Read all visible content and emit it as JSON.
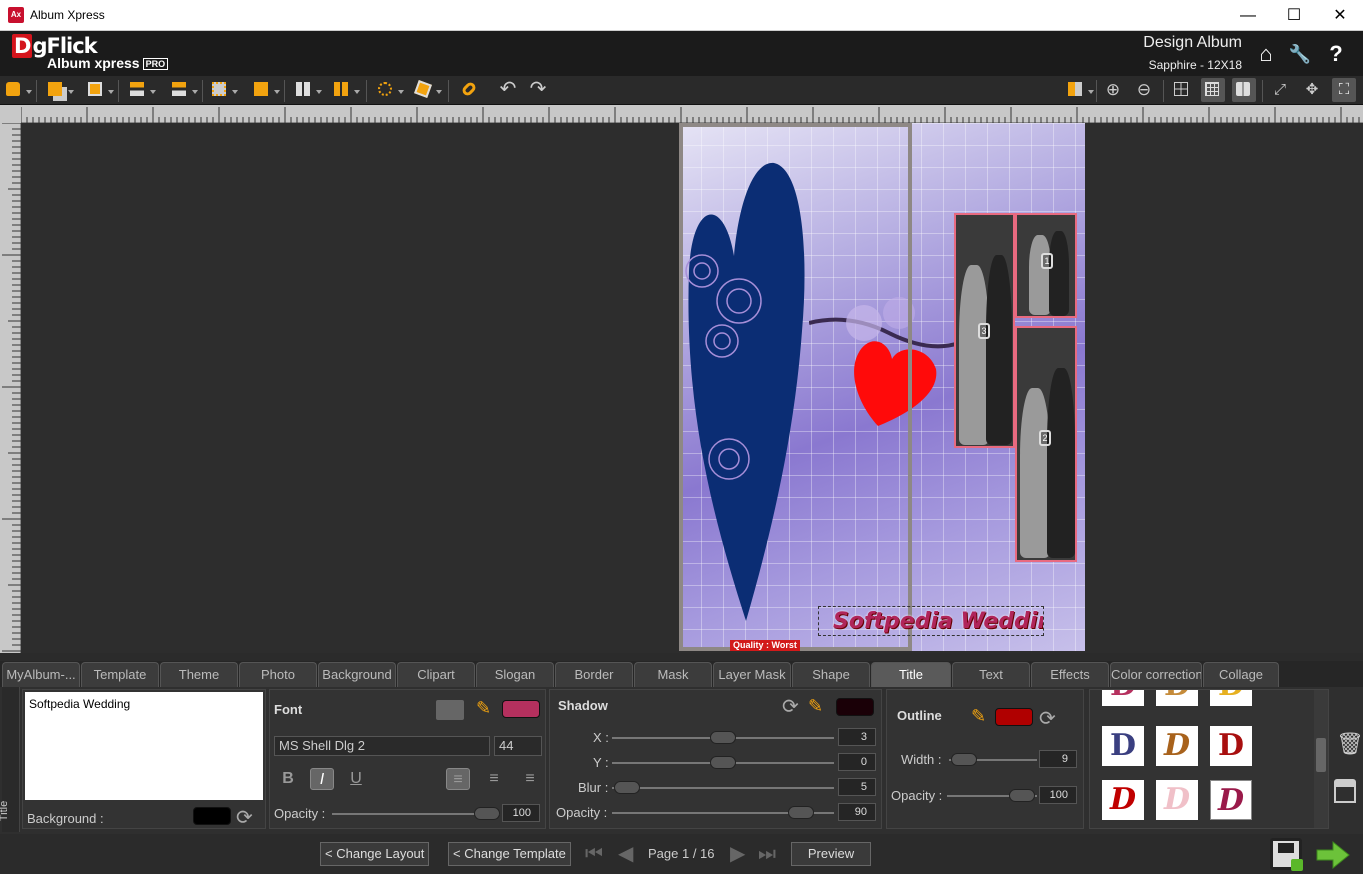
{
  "window": {
    "title": "Album Xpress",
    "minimize": "—",
    "maximize": "☐",
    "close": "✕"
  },
  "header": {
    "brand": "DgFlick",
    "brand_d": "D",
    "brand_rest": "gFlick",
    "product": "Album xpress",
    "edition": "PRO",
    "mode_title": "Design Album",
    "album_info": "Sapphire - 12X18",
    "home_icon": "⌂",
    "settings_icon": "🔧",
    "help_icon": "?"
  },
  "canvas": {
    "title_text": "Softpedia Wedding",
    "quality_badge": "Quality : Worst",
    "photo_numbers": [
      "3",
      "1",
      "2"
    ]
  },
  "tabs": [
    "MyAlbum-...",
    "Template",
    "Theme",
    "Photo",
    "Background",
    "Clipart",
    "Slogan",
    "Border",
    "Mask",
    "Layer Mask",
    "Shape",
    "Title",
    "Text",
    "Effects",
    "Color correction",
    "Collage"
  ],
  "active_tab": "Title",
  "title_panel": {
    "side_label": "Title",
    "text_value": "Softpedia Wedding",
    "background_label": "Background :",
    "background_color": "#000000"
  },
  "font_panel": {
    "heading": "Font",
    "font_name": "MS Shell Dlg 2",
    "font_size": "44",
    "color": "#b5305e",
    "bold": "B",
    "italic": "I",
    "underline": "U",
    "opacity_label": "Opacity :",
    "opacity_value": "100",
    "opacity_level": 1.0
  },
  "shadow_panel": {
    "heading": "Shadow",
    "color": "#1a0007",
    "x_label": "X :",
    "x_value": "3",
    "y_label": "Y :",
    "y_value": "0",
    "blur_label": "Blur :",
    "blur_value": "5",
    "opacity_label": "Opacity :",
    "opacity_value": "90"
  },
  "outline_panel": {
    "heading": "Outline",
    "color": "#b00000",
    "width_label": "Width :",
    "width_value": "9",
    "opacity_label": "Opacity :",
    "opacity_value": "100"
  },
  "footer": {
    "change_layout": "Change Layout",
    "change_template": "Change Template",
    "back_arrow": "<",
    "page_indicator": "Page 1 / 16",
    "preview": "Preview"
  },
  "colors": {
    "accent": "#f2a30f",
    "bg": "#2b2b2b",
    "active_tab": "#5a5a5a",
    "quality": "#d21a1a"
  }
}
